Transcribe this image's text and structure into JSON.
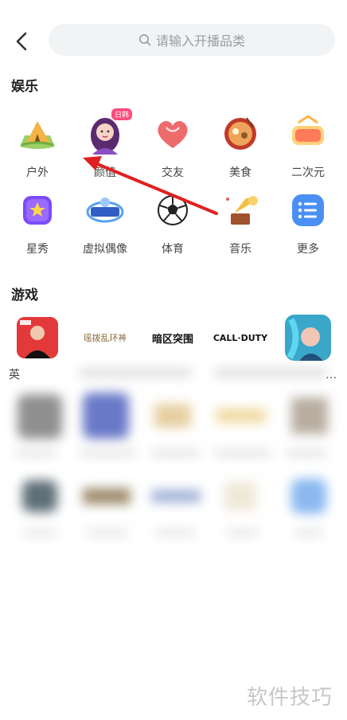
{
  "header": {
    "search_placeholder": "请输入开播品类"
  },
  "entertainment": {
    "title": "娱乐",
    "items": [
      {
        "label": "户外",
        "icon": "tent-icon"
      },
      {
        "label": "颜值",
        "icon": "avatar-girl-icon",
        "badge": "日韩"
      },
      {
        "label": "交友",
        "icon": "heart-icon"
      },
      {
        "label": "美食",
        "icon": "food-bowl-icon"
      },
      {
        "label": "二次元",
        "icon": "anime-icon"
      },
      {
        "label": "星秀",
        "icon": "star-show-icon"
      },
      {
        "label": "虚拟偶像",
        "icon": "virtual-idol-icon"
      },
      {
        "label": "体育",
        "icon": "soccer-ball-icon"
      },
      {
        "label": "音乐",
        "icon": "gramophone-icon"
      },
      {
        "label": "更多",
        "icon": "list-icon"
      }
    ]
  },
  "games": {
    "title": "游戏",
    "items": [
      {
        "label": "英",
        "icon": "lpl-player-icon"
      },
      {
        "label": "",
        "icon": "game-logo-icon",
        "logo_text": "瑶拨乱环神"
      },
      {
        "label": "",
        "icon": "game-logo-icon",
        "logo_text": "暗区突围"
      },
      {
        "label": "",
        "icon": "game-logo-icon",
        "logo_text": "CALL·DUTY"
      },
      {
        "label": "…",
        "icon": "lol-character-icon"
      }
    ]
  },
  "watermark": "软件技巧",
  "colors": {
    "accent_red": "#e02020",
    "search_bg": "#f2f3f5"
  }
}
